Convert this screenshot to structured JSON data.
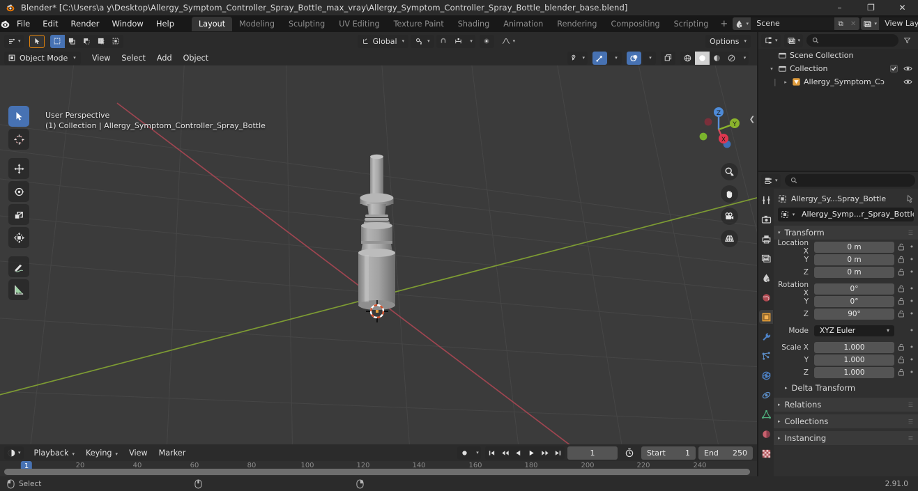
{
  "window": {
    "title": "Blender* [C:\\Users\\a y\\Desktop\\Allergy_Symptom_Controller_Spray_Bottle_max_vray\\Allergy_Symptom_Controller_Spray_Bottle_blender_base.blend]",
    "minimize": "–",
    "maximize": "❐",
    "close": "✕"
  },
  "menu": {
    "items": [
      "File",
      "Edit",
      "Render",
      "Window",
      "Help"
    ]
  },
  "workspace_tabs": [
    {
      "label": "Layout",
      "active": true
    },
    {
      "label": "Modeling",
      "active": false
    },
    {
      "label": "Sculpting",
      "active": false
    },
    {
      "label": "UV Editing",
      "active": false
    },
    {
      "label": "Texture Paint",
      "active": false
    },
    {
      "label": "Shading",
      "active": false
    },
    {
      "label": "Animation",
      "active": false
    },
    {
      "label": "Rendering",
      "active": false
    },
    {
      "label": "Compositing",
      "active": false
    },
    {
      "label": "Scripting",
      "active": false
    }
  ],
  "workspace_add": "+",
  "topbar_right": {
    "scene_name": "Scene",
    "viewlayer_name": "View Layer",
    "new_btn": "⧉",
    "unlink_btn": "✕"
  },
  "viewport": {
    "mode": "Object Mode",
    "menus": [
      "View",
      "Select",
      "Add",
      "Object"
    ],
    "transform_orientation": "Global",
    "options_label": "Options",
    "overlay_line1": "User Perspective",
    "overlay_line2": "(1) Collection | Allergy_Symptom_Controller_Spray_Bottle",
    "gizmo_axes": [
      "X",
      "Y",
      "Z"
    ],
    "tools": [
      "tweak-select-tool",
      "cursor-tool",
      "move-tool",
      "rotate-tool",
      "scale-tool",
      "transform-tool",
      "annotate-tool",
      "measure-tool"
    ],
    "nav_buttons": [
      "zoom-icon",
      "pan-hand-icon",
      "camera-icon",
      "ortho-grid-icon"
    ]
  },
  "timeline": {
    "editor_type": "timeline-icon",
    "menus": [
      "Playback",
      "Keying",
      "View",
      "Marker"
    ],
    "current_frame": "1",
    "start_label": "Start",
    "start_value": "1",
    "end_label": "End",
    "end_value": "250",
    "ticks": [
      "20",
      "40",
      "60",
      "80",
      "100",
      "120",
      "140",
      "160",
      "180",
      "200",
      "220",
      "240"
    ],
    "tick_positions": [
      115,
      197,
      279,
      361,
      441,
      521,
      601,
      682,
      762,
      843,
      923,
      1004
    ]
  },
  "outliner": {
    "search_placeholder": "",
    "rows": [
      {
        "label": "Scene Collection",
        "indent": 0,
        "icon": "collection-icon",
        "disclosure": "",
        "checkbox": false,
        "eye": false
      },
      {
        "label": "Collection",
        "indent": 1,
        "icon": "collection-icon",
        "disclosure": "▾",
        "checkbox": true,
        "eye": true
      },
      {
        "label": "Allergy_Symptom_Cɔ",
        "indent": 2,
        "icon": "mesh-object-icon",
        "disclosure": "▸",
        "checkbox": false,
        "eye": true
      }
    ]
  },
  "properties": {
    "search_placeholder": "",
    "breadcrumb": "Allergy_Sy...Spray_Bottle",
    "object_name": "Allergy_Symp...r_Spray_Bottle",
    "tabs": [
      "tool-icon",
      "render-icon",
      "output-icon",
      "view-layer-icon",
      "scene-icon",
      "world-icon",
      "object-icon",
      "modifiers-icon",
      "particles-icon",
      "physics-icon",
      "constraints-icon",
      "object-data-icon",
      "material-icon",
      "texture-icon"
    ],
    "transform_panel": "Transform",
    "rows": [
      {
        "label": "Location X",
        "value": "0 m"
      },
      {
        "label": "Y",
        "value": "0 m"
      },
      {
        "label": "Z",
        "value": "0 m"
      },
      {
        "label": "Rotation X",
        "value": "0°"
      },
      {
        "label": "Y",
        "value": "0°"
      },
      {
        "label": "Z",
        "value": "90°"
      },
      {
        "label": "Mode",
        "value": "XYZ Euler",
        "dropdown": true
      },
      {
        "label": "Scale X",
        "value": "1.000"
      },
      {
        "label": "Y",
        "value": "1.000"
      },
      {
        "label": "Z",
        "value": "1.000"
      }
    ],
    "subpanels": [
      {
        "label": "Delta Transform",
        "sub": true
      },
      {
        "label": "Relations",
        "sub": false
      },
      {
        "label": "Collections",
        "sub": false
      },
      {
        "label": "Instancing",
        "sub": false
      }
    ]
  },
  "statusbar": {
    "select_label": "Select",
    "version": "2.91.0"
  },
  "colors": {
    "accent_blue": "#4772b3",
    "accent_orange": "#e0820c",
    "panel_bg": "#303030",
    "header_bg": "#2b2b2b",
    "viewport_bg": "#3b3b3b",
    "axis_x": "#cc4b5a",
    "axis_y": "#9bbf3a"
  }
}
